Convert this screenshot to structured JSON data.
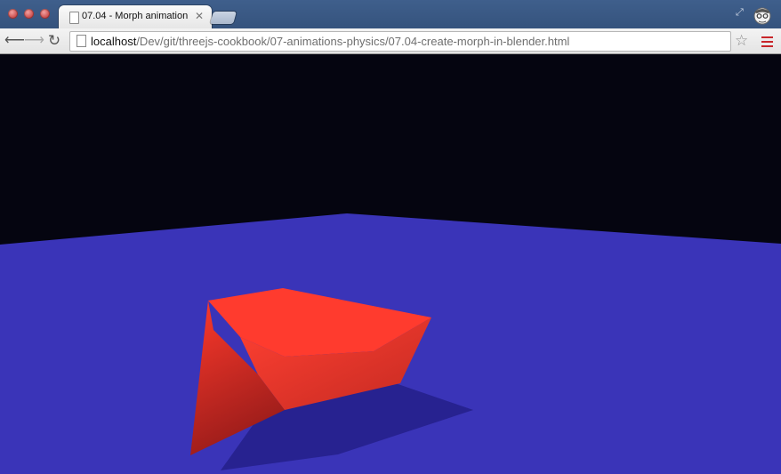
{
  "browser": {
    "tab": {
      "title": "07.04 - Morph animation",
      "close_glyph": "✕"
    },
    "omnibox": {
      "url_host": "localhost",
      "url_path": "/Dev/git/threejs-cookbook/07-animations-physics/07.04-create-morph-in-blender.html"
    },
    "icons": {
      "back": "arrow-left-icon",
      "forward": "arrow-right-icon",
      "reload": "reload-icon",
      "bookmark": "star-icon",
      "menu": "hamburger-menu-icon",
      "profile": "incognito-profile-icon",
      "resize": "resize-arrows-icon"
    }
  },
  "scene": {
    "background_color": "#050510",
    "plane_color": "#3a34b8",
    "shape_color": "#ff3b2e",
    "shadow_color": "#272290"
  }
}
